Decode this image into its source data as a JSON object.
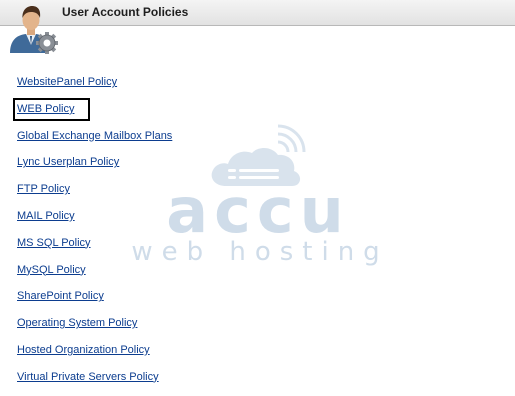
{
  "header": {
    "title": "User Account Policies",
    "icon": "user-gear-icon"
  },
  "watermark": {
    "brand": "accu",
    "tagline": "web hosting",
    "icon": "cloud-icon",
    "color": "#c9d8e7"
  },
  "policies": [
    {
      "label": "WebsitePanel Policy"
    },
    {
      "label": "WEB Policy"
    },
    {
      "label": "Global Exchange Mailbox Plans"
    },
    {
      "label": "Lync Userplan Policy"
    },
    {
      "label": "FTP Policy"
    },
    {
      "label": "MAIL Policy"
    },
    {
      "label": "MS SQL Policy"
    },
    {
      "label": "MySQL Policy"
    },
    {
      "label": "SharePoint Policy"
    },
    {
      "label": "Operating System Policy"
    },
    {
      "label": "Hosted Organization Policy"
    },
    {
      "label": "Virtual Private Servers Policy"
    }
  ],
  "colors": {
    "link": "#0c3d8f",
    "header_bg": "#e8e8e8",
    "highlight": "#000000"
  }
}
